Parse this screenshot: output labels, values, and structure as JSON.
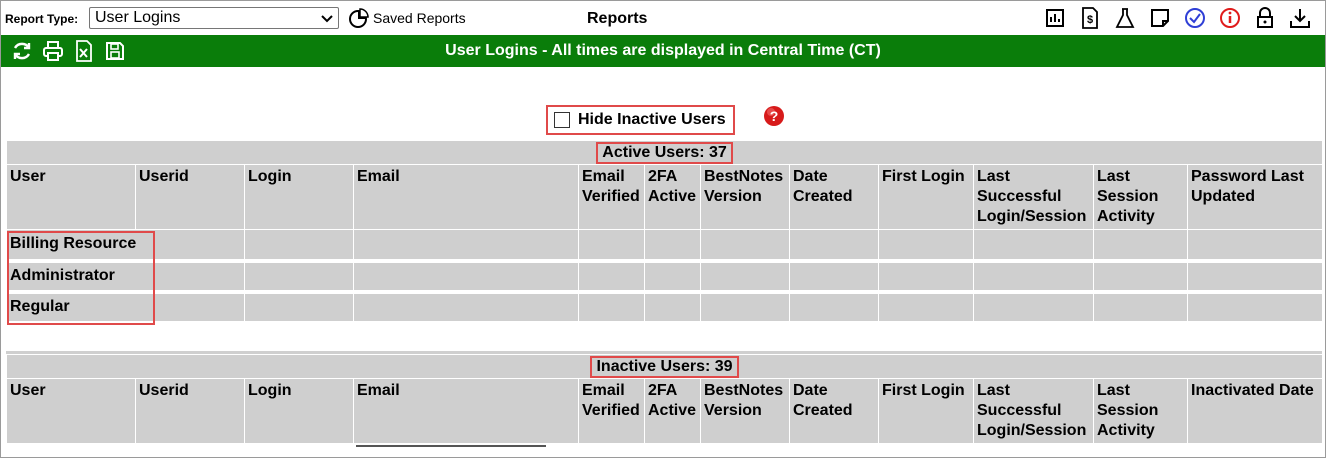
{
  "toolbar": {
    "report_type_label": "Report Type:",
    "report_type_value": "User Logins",
    "saved_reports_label": "Saved Reports",
    "title": "Reports",
    "right_icons": [
      "bar-chart-icon",
      "dollar-document-icon",
      "flask-icon",
      "note-icon",
      "check-circle-icon",
      "info-circle-icon",
      "lock-icon",
      "download-icon"
    ]
  },
  "banner": {
    "title": "User Logins - All times are displayed in Central Time (CT)",
    "icons": [
      "refresh-icon",
      "print-icon",
      "excel-icon",
      "save-icon"
    ],
    "color": "#0a7d0a"
  },
  "filter": {
    "hide_inactive_label": "Hide Inactive Users",
    "hide_inactive_checked": false
  },
  "active": {
    "caption": "Active Users: 37",
    "columns": [
      "User",
      "Userid",
      "Login",
      "Email",
      "Email Verified",
      "2FA Active",
      "BestNotes Version",
      "Date Created",
      "First Login",
      "Last Successful Login/Session",
      "Last Session Activity",
      "Password Last Updated"
    ],
    "groups": [
      "Billing Resource",
      "Administrator",
      "Regular"
    ]
  },
  "inactive": {
    "caption": "Inactive Users: 39",
    "columns": [
      "User",
      "Userid",
      "Login",
      "Email",
      "Email Verified",
      "2FA Active",
      "BestNotes Version",
      "Date Created",
      "First Login",
      "Last Successful Login/Session",
      "Last Session Activity",
      "Inactivated Date"
    ]
  },
  "colors": {
    "highlight": "#e04a4a",
    "table_bg": "#cfcfcf"
  }
}
